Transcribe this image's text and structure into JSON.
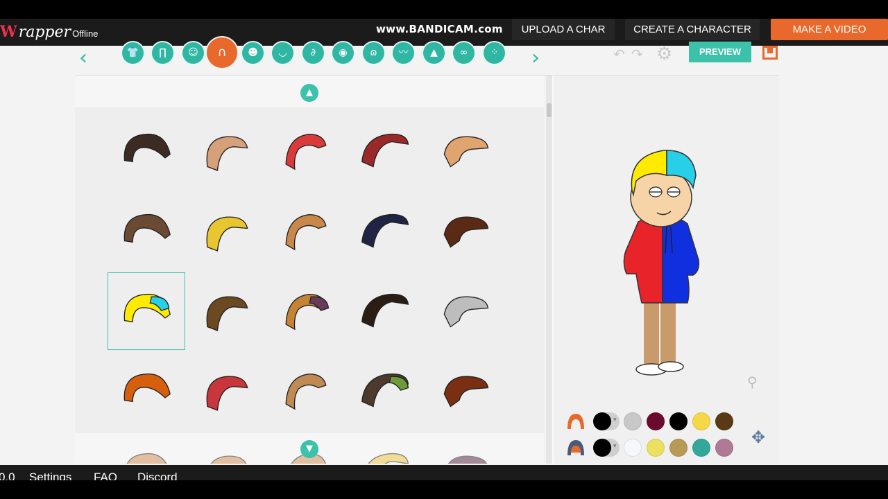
{
  "header": {
    "logo_mark": "W",
    "logo_text": "rapper",
    "logo_status": "Offline",
    "watermark": "www.BANDICAM.com",
    "nav": {
      "upload": "UPLOAD A CHAR",
      "create": "CREATE A CHARACTER",
      "video": "MAKE A VIDEO"
    }
  },
  "toolbar": {
    "prev_arrow": "‹",
    "next_arrow": "›",
    "categories": [
      {
        "name": "upper-body",
        "icon": "shirt-icon",
        "glyph": "👕"
      },
      {
        "name": "lower-body",
        "icon": "pants-icon",
        "glyph": "∏"
      },
      {
        "name": "head",
        "icon": "head-icon",
        "glyph": "☺"
      },
      {
        "name": "hair",
        "icon": "hair-icon",
        "glyph": "∩",
        "active": true
      },
      {
        "name": "face",
        "icon": "face-icon",
        "glyph": "☻"
      },
      {
        "name": "mouth",
        "icon": "lips-icon",
        "glyph": "◡"
      },
      {
        "name": "ears",
        "icon": "ear-icon",
        "glyph": "∂"
      },
      {
        "name": "eyes",
        "icon": "eye-icon",
        "glyph": "◉"
      },
      {
        "name": "mustache",
        "icon": "mustache-icon",
        "glyph": "ɷ"
      },
      {
        "name": "eyebrows",
        "icon": "eyebrows-icon",
        "glyph": "〰"
      },
      {
        "name": "nose",
        "icon": "nose-icon",
        "glyph": "▲"
      },
      {
        "name": "glasses",
        "icon": "glasses-icon",
        "glyph": "∞"
      },
      {
        "name": "accessories",
        "icon": "dots-icon",
        "glyph": "⁘"
      }
    ],
    "undo": "↶",
    "redo": "↷",
    "settings": "⚙",
    "preview_label": "PREVIEW"
  },
  "hair_grid": {
    "scroll_up": "▲",
    "scroll_down": "▼",
    "items": [
      {
        "color": "#3b2b22"
      },
      {
        "color": "#d6a07a"
      },
      {
        "color": "#d93b3b"
      },
      {
        "color": "#9a2a2a"
      },
      {
        "color": "#e0a46f"
      },
      {
        "color": "#6b4a33"
      },
      {
        "color": "#e8c630"
      },
      {
        "color": "#c8884a"
      },
      {
        "color": "#1f2444"
      },
      {
        "color": "#5a2a14"
      },
      {
        "color": "#ffea00",
        "accent": "#27d0e8",
        "selected": true
      },
      {
        "color": "#6b4a22"
      },
      {
        "color": "#c48434",
        "accent": "#6a3a5a"
      },
      {
        "color": "#2a1d14"
      },
      {
        "color": "#bdbdbd"
      },
      {
        "color": "#d65f0e"
      },
      {
        "color": "#c8353a"
      },
      {
        "color": "#c08a52"
      },
      {
        "color": "#4c3a2c",
        "accent": "#6f9a3c"
      },
      {
        "color": "#7a2f12"
      },
      {
        "color": "#c88b52"
      },
      {
        "color": "#c88b52"
      },
      {
        "color": "#c88b52"
      },
      {
        "color": "#e8c040"
      },
      {
        "color": "#5a2b42"
      }
    ]
  },
  "palette": {
    "row1_colors": [
      "#000000",
      "#c8c8c8",
      "#6a0b2e",
      "#000000",
      "#f4d848",
      "#5a3a14"
    ],
    "row2_colors": [
      "#000000",
      "#f4f8f8",
      "#ece060",
      "#b89a56",
      "#33a89a",
      "#b07a96"
    ],
    "icon1": "hair-front-icon",
    "icon2": "hair-back-icon"
  },
  "character": {
    "hair_main": "#ffea00",
    "hair_accent": "#27d0e8",
    "hoodie_left": "#e8232a",
    "hoodie_right": "#1030e0",
    "pants": "#c99a6a",
    "skin": "#f6d4a8"
  },
  "footer": {
    "version": "0.0",
    "settings": "Settings",
    "faq": "FAQ",
    "discord": "Discord"
  }
}
